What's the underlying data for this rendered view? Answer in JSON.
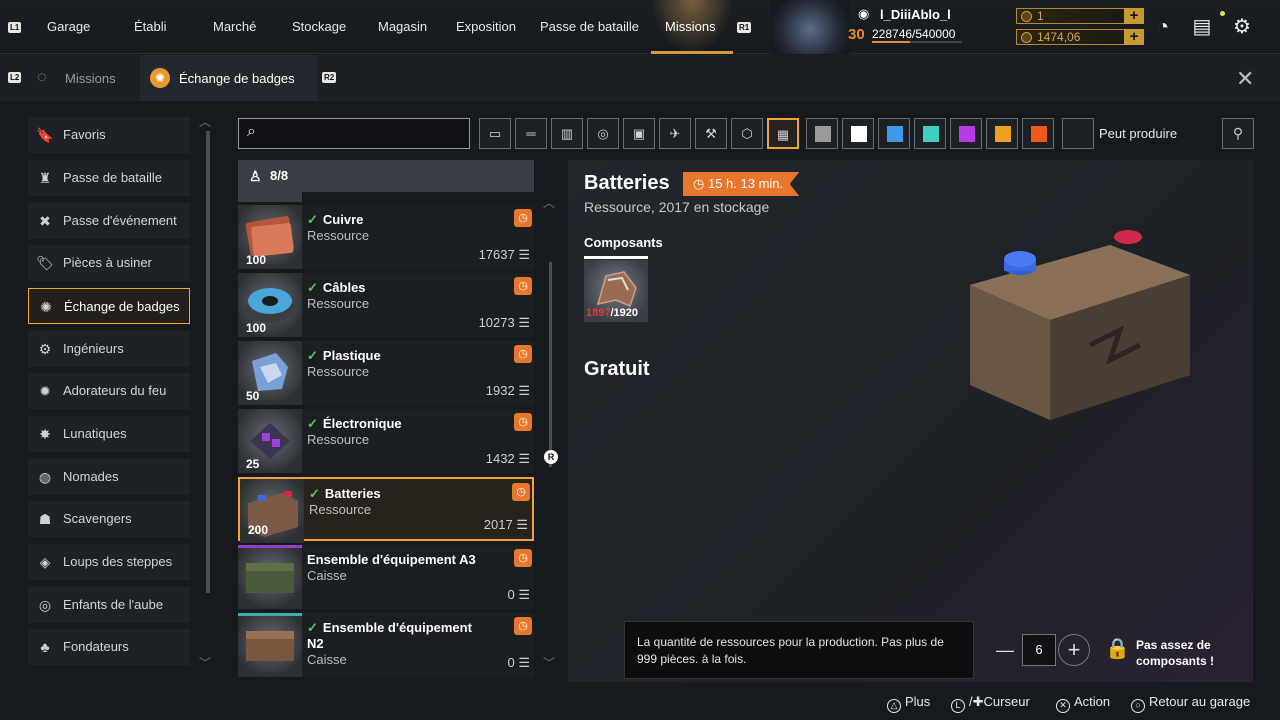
{
  "topnav": {
    "hint_left": "L1",
    "hint_right": "R1",
    "items": [
      "Garage",
      "Établi",
      "Marché",
      "Stockage",
      "Magasin",
      "Exposition",
      "Passe de bataille",
      "Missions"
    ],
    "active_index": 7
  },
  "player": {
    "name": "l_DiiiAblo_l",
    "level": "30",
    "xp": "228746/540000"
  },
  "currency": {
    "coins": "1",
    "gold": "1474,06"
  },
  "subnav": {
    "hint_left": "L2",
    "hint_right": "R2",
    "tab_missions": "Missions",
    "tab_badges": "Échange de badges"
  },
  "sidebar": {
    "items": [
      {
        "label": "Favoris",
        "icon": "bookmark-icon",
        "glyph": "🔖"
      },
      {
        "label": "Passe de bataille",
        "icon": "battle-pass-icon",
        "glyph": "♜"
      },
      {
        "label": "Passe d'événement",
        "icon": "event-pass-icon",
        "glyph": "✖"
      },
      {
        "label": "Pièces à usiner",
        "icon": "tag-icon",
        "glyph": "🏷"
      },
      {
        "label": "Échange de badges",
        "icon": "badge-exchange-icon",
        "glyph": "✺"
      },
      {
        "label": "Ingénieurs",
        "icon": "engineers-icon",
        "glyph": "⚙"
      },
      {
        "label": "Adorateurs du feu",
        "icon": "firestarters-icon",
        "glyph": "✹"
      },
      {
        "label": "Lunatiques",
        "icon": "lunatics-icon",
        "glyph": "✸"
      },
      {
        "label": "Nomades",
        "icon": "nomads-icon",
        "glyph": "◍"
      },
      {
        "label": "Scavengers",
        "icon": "scavengers-icon",
        "glyph": "☗"
      },
      {
        "label": "Loups des steppes",
        "icon": "steppenwolfs-icon",
        "glyph": "◈"
      },
      {
        "label": "Enfants de l'aube",
        "icon": "dawns-children-icon",
        "glyph": "◎"
      },
      {
        "label": "Fondateurs",
        "icon": "founders-icon",
        "glyph": "♣"
      }
    ],
    "active_index": 4
  },
  "toolbar": {
    "search_placeholder": "",
    "can_produce": "Peut produire"
  },
  "list": {
    "header_count": "8/8",
    "items": [
      {
        "name": "Cuivre",
        "type": "Ressource",
        "qty": "100",
        "count": "17637",
        "checked": true
      },
      {
        "name": "Câbles",
        "type": "Ressource",
        "qty": "100",
        "count": "10273",
        "checked": true
      },
      {
        "name": "Plastique",
        "type": "Ressource",
        "qty": "50",
        "count": "1932",
        "checked": true
      },
      {
        "name": "Électronique",
        "type": "Ressource",
        "qty": "25",
        "count": "1432",
        "checked": true
      },
      {
        "name": "Batteries",
        "type": "Ressource",
        "qty": "200",
        "count": "2017",
        "checked": true
      },
      {
        "name": "Ensemble d'équipement A3",
        "type": "Caisse",
        "qty": "",
        "count": "0",
        "checked": false
      },
      {
        "name": "Ensemble d'équipement N2",
        "type": "Caisse",
        "qty": "",
        "count": "0",
        "checked": true
      }
    ],
    "active_index": 4
  },
  "detail": {
    "title": "Batteries",
    "timer": "15 h. 13 min.",
    "subtitle": "Ressource, 2017 en stockage",
    "components_label": "Composants",
    "component_have": "1897",
    "component_need": "/1920",
    "price": "Gratuit"
  },
  "production": {
    "tooltip": "La quantité de ressources pour la production. Pas plus de 999 pièces. à la fois.",
    "quantity": "6",
    "not_enough": "Pas assez de composants !"
  },
  "footer": {
    "plus": "Plus",
    "cursor": "Curseur",
    "action": "Action",
    "back": "Retour au garage"
  },
  "colors": {
    "accent": "#f0a43a",
    "timer": "#e8762c",
    "check": "#59c463",
    "danger": "#e23a3a"
  }
}
